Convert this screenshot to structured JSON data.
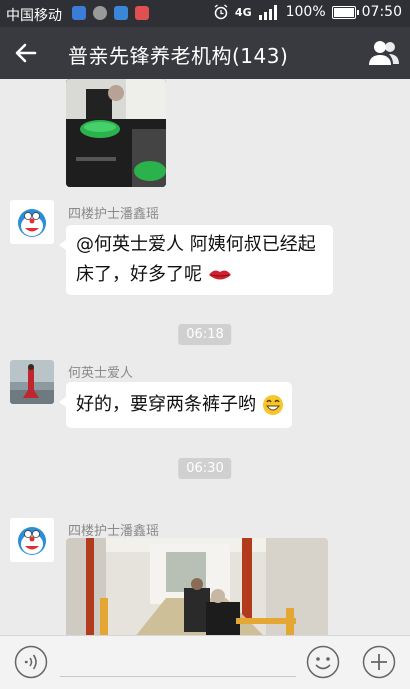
{
  "status_bar": {
    "carrier": "中国移动",
    "network_top": "4G",
    "network_bottom": "4G",
    "battery": "100%",
    "time": "07:50"
  },
  "header": {
    "title": "普亲先锋养老机构(143)"
  },
  "messages": [
    {
      "type": "image",
      "sender": "",
      "description": "photo",
      "icon": "photo"
    },
    {
      "type": "text",
      "sender": "四楼护士潘鑫瑶",
      "line1": "@何英士爱人 阿姨何叔已经起",
      "line2": "床了，好多了呢",
      "emoji": "lips"
    },
    {
      "type": "time",
      "text": "06:18"
    },
    {
      "type": "text",
      "sender": "何英士爱人",
      "line1": "好的，要穿两条裤子哟",
      "emoji": "smile"
    },
    {
      "type": "time",
      "text": "06:30"
    },
    {
      "type": "image",
      "sender": "四楼护士潘鑫瑶"
    }
  ],
  "icons": {
    "back": "arrow-left-icon",
    "group": "group-members-icon",
    "voice": "voice-icon",
    "emoji": "emoji-icon",
    "more": "plus-icon"
  },
  "colors": {
    "titlebar": "#393a3f",
    "statusbar": "#2e3035",
    "chat_bg": "#ebebeb",
    "bubble": "#ffffff"
  }
}
